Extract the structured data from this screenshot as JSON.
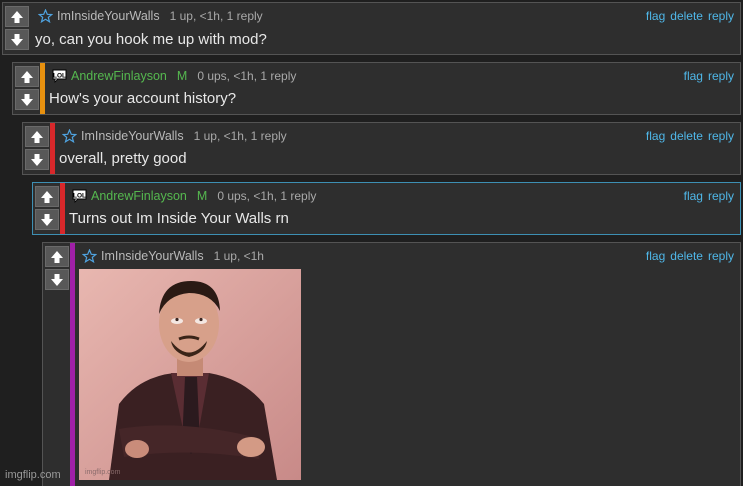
{
  "colors": {
    "upvote_arrow": "#ffffff",
    "username_green": "#55b84f",
    "link_blue": "#4fb7e8",
    "thread_bar_1": "#e8910f",
    "thread_bar_2": "#d8282b",
    "thread_bar_3": "#d8282b",
    "thread_bar_4": "#a020a8"
  },
  "comments": [
    {
      "badge_icon": "star-icon",
      "username": "ImInsideYourWalls",
      "meta": "1 up, <1h, 1 reply",
      "text": "yo, can you hook me up with mod?",
      "actions": [
        "flag",
        "delete",
        "reply"
      ]
    },
    {
      "badge_icon": "lol-icon",
      "username": "AndrewFinlayson",
      "mod_badge": "M",
      "meta": "0 ups, <1h, 1 reply",
      "text": "How's your account history?",
      "actions": [
        "flag",
        "reply"
      ]
    },
    {
      "badge_icon": "star-icon",
      "username": "ImInsideYourWalls",
      "meta": "1 up, <1h, 1 reply",
      "text": "overall, pretty good",
      "actions": [
        "flag",
        "delete",
        "reply"
      ]
    },
    {
      "badge_icon": "lol-icon",
      "username": "AndrewFinlayson",
      "mod_badge": "M",
      "meta": "0 ups, <1h, 1 reply",
      "text": "Turns out Im Inside Your Walls rn",
      "actions": [
        "flag",
        "reply"
      ]
    },
    {
      "badge_icon": "star-icon",
      "username": "ImInsideYourWalls",
      "meta": "1 up, <1h",
      "image": "eye-roll-meme-image",
      "image_watermark": "imgflip.com",
      "actions": [
        "flag",
        "delete",
        "reply"
      ]
    }
  ],
  "watermark": "imgflip.com"
}
